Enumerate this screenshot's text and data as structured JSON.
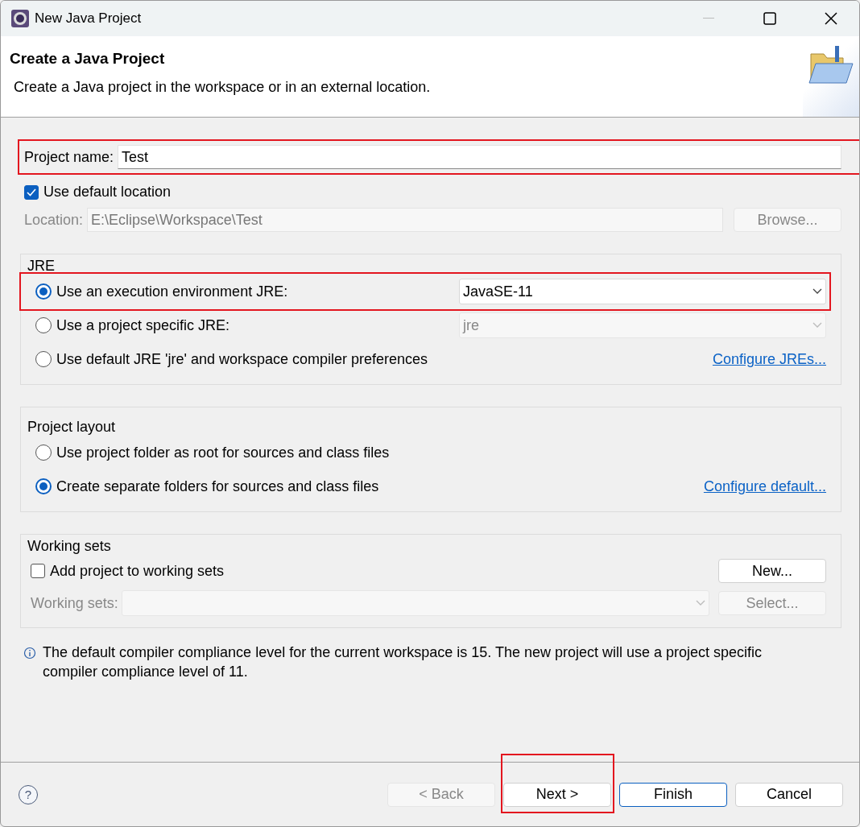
{
  "window": {
    "title": "New Java Project"
  },
  "header": {
    "title": "Create a Java Project",
    "description": "Create a Java project in the workspace or in an external location."
  },
  "project_name": {
    "label": "Project name:",
    "value": "Test",
    "highlighted": true
  },
  "default_location": {
    "label": "Use default location",
    "checked": true
  },
  "location": {
    "label": "Location:",
    "value": "E:\\Eclipse\\Workspace\\Test",
    "disabled": true,
    "button": "Browse..."
  },
  "jre": {
    "title": "JRE",
    "options": [
      {
        "kind": "dropdown",
        "label": "Use an execution environment JRE:",
        "selected": true,
        "value": "JavaSE-11",
        "disabled": false,
        "highlighted": true
      },
      {
        "kind": "dropdown",
        "label": "Use a project specific JRE:",
        "selected": false,
        "value": "jre",
        "disabled": true,
        "highlighted": false
      },
      {
        "kind": "link",
        "label": "Use default JRE 'jre' and workspace compiler preferences",
        "selected": false,
        "link": "Configure JREs...",
        "highlighted": false
      }
    ]
  },
  "project_layout": {
    "title": "Project layout",
    "options": [
      {
        "kind": "plain",
        "label": "Use project folder as root for sources and class files",
        "selected": false
      },
      {
        "kind": "link",
        "label": "Create separate folders for sources and class files",
        "selected": true,
        "link": "Configure default..."
      }
    ]
  },
  "working_sets": {
    "title": "Working sets",
    "add": {
      "label": "Add project to working sets",
      "checked": false
    },
    "new_button": "New...",
    "field": {
      "label": "Working sets:",
      "disabled": true
    },
    "select_button": {
      "label": "Select...",
      "disabled": true
    }
  },
  "info": "The default compiler compliance level for the current workspace is 15. The new project will use a project specific compiler compliance level of 11.",
  "help": "?",
  "buttons": [
    {
      "label": "< Back",
      "disabled": true,
      "default": false,
      "highlighted": false
    },
    {
      "label": "Next >",
      "disabled": false,
      "default": false,
      "highlighted": true
    },
    {
      "label": "Finish",
      "disabled": false,
      "default": true,
      "highlighted": false
    },
    {
      "label": "Cancel",
      "disabled": false,
      "default": false,
      "highlighted": false
    }
  ]
}
